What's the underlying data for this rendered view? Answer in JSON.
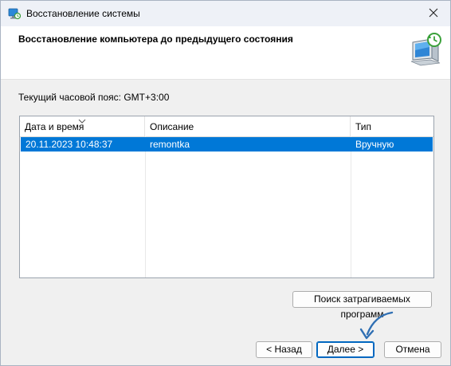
{
  "window": {
    "title": "Восстановление системы",
    "heading": "Восстановление компьютера до предыдущего состояния"
  },
  "timezone_label": "Текущий часовой пояс: GMT+3:00",
  "table": {
    "columns": [
      "Дата и время",
      "Описание",
      "Тип"
    ],
    "rows": [
      {
        "datetime": "20.11.2023 10:48:37",
        "description": "remontka",
        "type": "Вручную"
      }
    ]
  },
  "buttons": {
    "scan": "Поиск затрагиваемых программ",
    "back": "< Назад",
    "next": "Далее >",
    "cancel": "Отмена"
  },
  "colors": {
    "selection": "#0078d7",
    "annotation_arrow": "#2f6fb3"
  },
  "icons": {
    "title": "system-restore-icon",
    "header": "monitor-restore-icon",
    "close": "close-icon",
    "sort": "sort-down-icon"
  }
}
